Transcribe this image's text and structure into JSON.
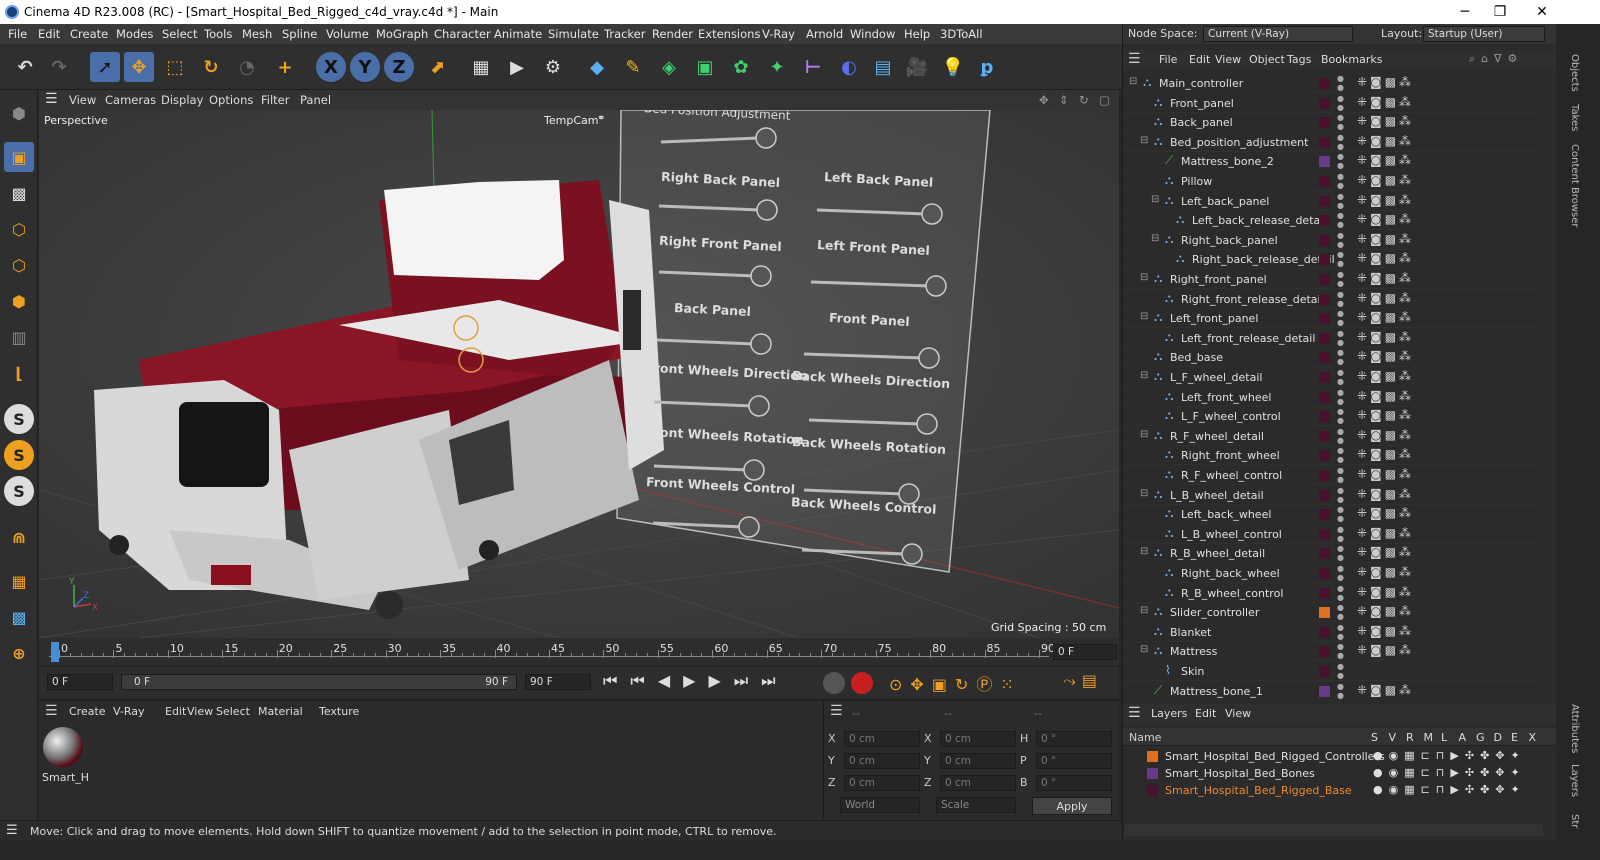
{
  "window": {
    "title": "Cinema 4D R23.008 (RC) - [Smart_Hospital_Bed_Rigged_c4d_vray.c4d *] - Main"
  },
  "menubar": {
    "items": [
      "File",
      "Edit",
      "Create",
      "Modes",
      "Select",
      "Tools",
      "Mesh",
      "Spline",
      "Volume",
      "MoGraph",
      "Character",
      "Animate",
      "Simulate",
      "Tracker",
      "Render",
      "Extensions",
      "V-Ray",
      "Arnold",
      "Window",
      "Help",
      "3DToAll"
    ]
  },
  "nodespace": {
    "label": "Node Space:",
    "value": "Current (V-Ray)",
    "layout_label": "Layout:",
    "layout_value": "Startup (User)"
  },
  "viewport": {
    "menu": [
      "View",
      "Cameras",
      "Display",
      "Options",
      "Filter",
      "Panel"
    ],
    "name": "Perspective",
    "camera": "TempCam",
    "grid_spacing": "Grid Spacing : 50 cm",
    "sliders": {
      "top": "Bed Position Adjustment",
      "labels": [
        "Right Back Panel",
        "Left Back Panel",
        "Right Front Panel",
        "Left Front Panel",
        "Back Panel",
        "Front Panel",
        "Front Wheels Direction",
        "Back Wheels Direction",
        "Front Wheels Rotation",
        "Back Wheels Rotation",
        "Front Wheels Control",
        "Back Wheels Control"
      ]
    }
  },
  "timeline": {
    "ticks": [
      "0",
      "5",
      "10",
      "15",
      "20",
      "25",
      "30",
      "35",
      "40",
      "45",
      "50",
      "55",
      "60",
      "65",
      "70",
      "75",
      "80",
      "85",
      "90"
    ],
    "frame_field": "0 F",
    "start": "0 F",
    "range_start": "0 F",
    "range_end": "90 F",
    "end": "90 F"
  },
  "materials": {
    "menu": [
      "Create",
      "V-Ray",
      "Edit",
      "View",
      "Select",
      "Material",
      "Texture"
    ],
    "item": "Smart_H"
  },
  "coords": {
    "header": [
      "--",
      "--",
      "--"
    ],
    "rows": [
      {
        "a": "X",
        "av": "0 cm",
        "b": "X",
        "bv": "0 cm",
        "c": "H",
        "cv": "0 °"
      },
      {
        "a": "Y",
        "av": "0 cm",
        "b": "Y",
        "bv": "0 cm",
        "c": "P",
        "cv": "0 °"
      },
      {
        "a": "Z",
        "av": "0 cm",
        "b": "Z",
        "bv": "0 cm",
        "c": "B",
        "cv": "0 °"
      }
    ],
    "world": "World",
    "scale": "Scale",
    "apply": "Apply"
  },
  "status": "Move: Click and drag to move elements. Hold down SHIFT to quantize movement / add to the selection in point mode, CTRL to remove.",
  "objects": {
    "menu": [
      "File",
      "Edit",
      "View",
      "Object",
      "Tags",
      "Bookmarks"
    ],
    "tree": [
      {
        "name": "Main_controller",
        "depth": 0,
        "fold": true
      },
      {
        "name": "Front_panel",
        "depth": 1,
        "fold": false
      },
      {
        "name": "Back_panel",
        "depth": 1,
        "fold": false
      },
      {
        "name": "Bed_position_adjustment",
        "depth": 1,
        "fold": true
      },
      {
        "name": "Mattress_bone_2",
        "depth": 2,
        "fold": false
      },
      {
        "name": "Pillow",
        "depth": 2,
        "fold": false
      },
      {
        "name": "Left_back_panel",
        "depth": 2,
        "fold": true
      },
      {
        "name": "Left_back_release_detail",
        "depth": 3,
        "fold": false
      },
      {
        "name": "Right_back_panel",
        "depth": 2,
        "fold": true
      },
      {
        "name": "Right_back_release_detail",
        "depth": 3,
        "fold": false
      },
      {
        "name": "Right_front_panel",
        "depth": 1,
        "fold": true
      },
      {
        "name": "Right_front_release_detail",
        "depth": 2,
        "fold": false
      },
      {
        "name": "Left_front_panel",
        "depth": 1,
        "fold": true
      },
      {
        "name": "Left_front_release_detail",
        "depth": 2,
        "fold": false
      },
      {
        "name": "Bed_base",
        "depth": 1,
        "fold": false
      },
      {
        "name": "L_F_wheel_detail",
        "depth": 1,
        "fold": true
      },
      {
        "name": "Left_front_wheel",
        "depth": 2,
        "fold": false
      },
      {
        "name": "L_F_wheel_control",
        "depth": 2,
        "fold": false
      },
      {
        "name": "R_F_wheel_detail",
        "depth": 1,
        "fold": true
      },
      {
        "name": "Right_front_wheel",
        "depth": 2,
        "fold": false
      },
      {
        "name": "R_F_wheel_control",
        "depth": 2,
        "fold": false
      },
      {
        "name": "L_B_wheel_detail",
        "depth": 1,
        "fold": true
      },
      {
        "name": "Left_back_wheel",
        "depth": 2,
        "fold": false
      },
      {
        "name": "L_B_wheel_control",
        "depth": 2,
        "fold": false
      },
      {
        "name": "R_B_wheel_detail",
        "depth": 1,
        "fold": true
      },
      {
        "name": "Right_back_wheel",
        "depth": 2,
        "fold": false
      },
      {
        "name": "R_B_wheel_control",
        "depth": 2,
        "fold": false
      },
      {
        "name": "Slider_controller",
        "depth": 1,
        "fold": true
      },
      {
        "name": "Blanket",
        "depth": 1,
        "fold": false
      },
      {
        "name": "Mattress",
        "depth": 1,
        "fold": true
      },
      {
        "name": "Skin",
        "depth": 2,
        "fold": false
      },
      {
        "name": "Mattress_bone_1",
        "depth": 1,
        "fold": false
      }
    ]
  },
  "layers": {
    "menu": [
      "Layers",
      "Edit",
      "View"
    ],
    "col_name": "Name",
    "cols": [
      "S",
      "V",
      "R",
      "M",
      "L",
      "A",
      "G",
      "D",
      "E",
      "X"
    ],
    "items": [
      {
        "name": "Smart_Hospital_Bed_Rigged_Controllers",
        "color": "#e07020"
      },
      {
        "name": "Smart_Hospital_Bed_Bones",
        "color": "#6a3a8a"
      },
      {
        "name": "Smart_Hospital_Bed_Rigged_Base",
        "color": "#4a1030"
      }
    ]
  },
  "side_tabs": [
    "Objects",
    "Takes",
    "Content Browser",
    "Attributes",
    "Layers",
    "Str"
  ]
}
